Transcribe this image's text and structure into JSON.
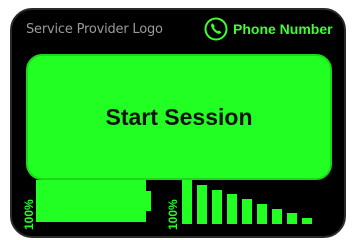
{
  "header": {
    "logo_text": "Service Provider Logo",
    "phone_label": "Phone Number",
    "phone_icon": "phone-icon"
  },
  "main": {
    "start_label": "Start Session"
  },
  "status": {
    "battery_label": "100%",
    "battery_level": 1.0,
    "signal_label": "100%",
    "signal_bar_count": 9
  },
  "colors": {
    "accent": "#22ff22",
    "background": "#000000",
    "logo_text": "#9a9a9a"
  }
}
